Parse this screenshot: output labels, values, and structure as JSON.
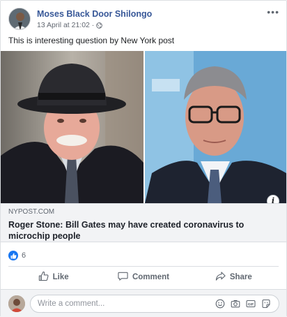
{
  "post": {
    "author": "Moses Black Door Shilongo",
    "timestamp": "13 April at 21:02 ·",
    "privacy_icon": "globe-icon",
    "more_label": "•••",
    "text": "This is interesting question by New York post"
  },
  "link": {
    "domain": "NYPOST.COM",
    "title": "Roger Stone: Bill Gates may have created coronavirus to microchip people",
    "info_label": "i"
  },
  "reactions": {
    "icon": "like-reaction-icon",
    "count": "6"
  },
  "actions": {
    "like": "Like",
    "comment": "Comment",
    "share": "Share"
  },
  "comment_box": {
    "placeholder": "Write a comment...",
    "icons": [
      "emoji-icon",
      "camera-icon",
      "gif-icon",
      "sticker-icon"
    ]
  },
  "colors": {
    "author": "#385898",
    "like_blue": "#1877f2",
    "secondary_text": "#606770",
    "link_bg": "#f2f3f5"
  }
}
